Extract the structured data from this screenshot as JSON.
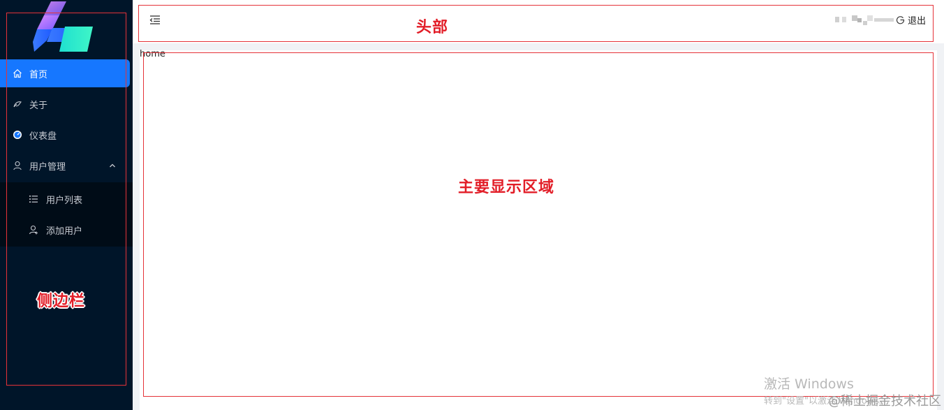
{
  "sidebar": {
    "logo": "logo-icon",
    "items": [
      {
        "label": "首页",
        "icon": "home-icon",
        "active": true
      },
      {
        "label": "关于",
        "icon": "leaf-icon"
      },
      {
        "label": "仪表盘",
        "icon": "dashboard-icon"
      },
      {
        "label": "用户管理",
        "icon": "user-icon",
        "expanded": true
      }
    ],
    "submenu": [
      {
        "label": "用户列表",
        "icon": "list-icon"
      },
      {
        "label": "添加用户",
        "icon": "user-add-icon"
      }
    ]
  },
  "header": {
    "collapse_icon": "menu-fold-icon",
    "logout_label": "退出",
    "logout_icon": "logout-icon"
  },
  "main": {
    "page_text": "home"
  },
  "annotations": {
    "header": "头部",
    "main": "主要显示区域",
    "sidebar": "侧边栏"
  },
  "overlay": {
    "activation_title": "激活 Windows",
    "activation_sub": "转到\"设置\"以激活 Windows。",
    "source": "@稀土掘金技术社区"
  },
  "colors": {
    "sidebar_bg": "#001529",
    "active_item": "#1677ff",
    "annotation": "#e53238"
  }
}
